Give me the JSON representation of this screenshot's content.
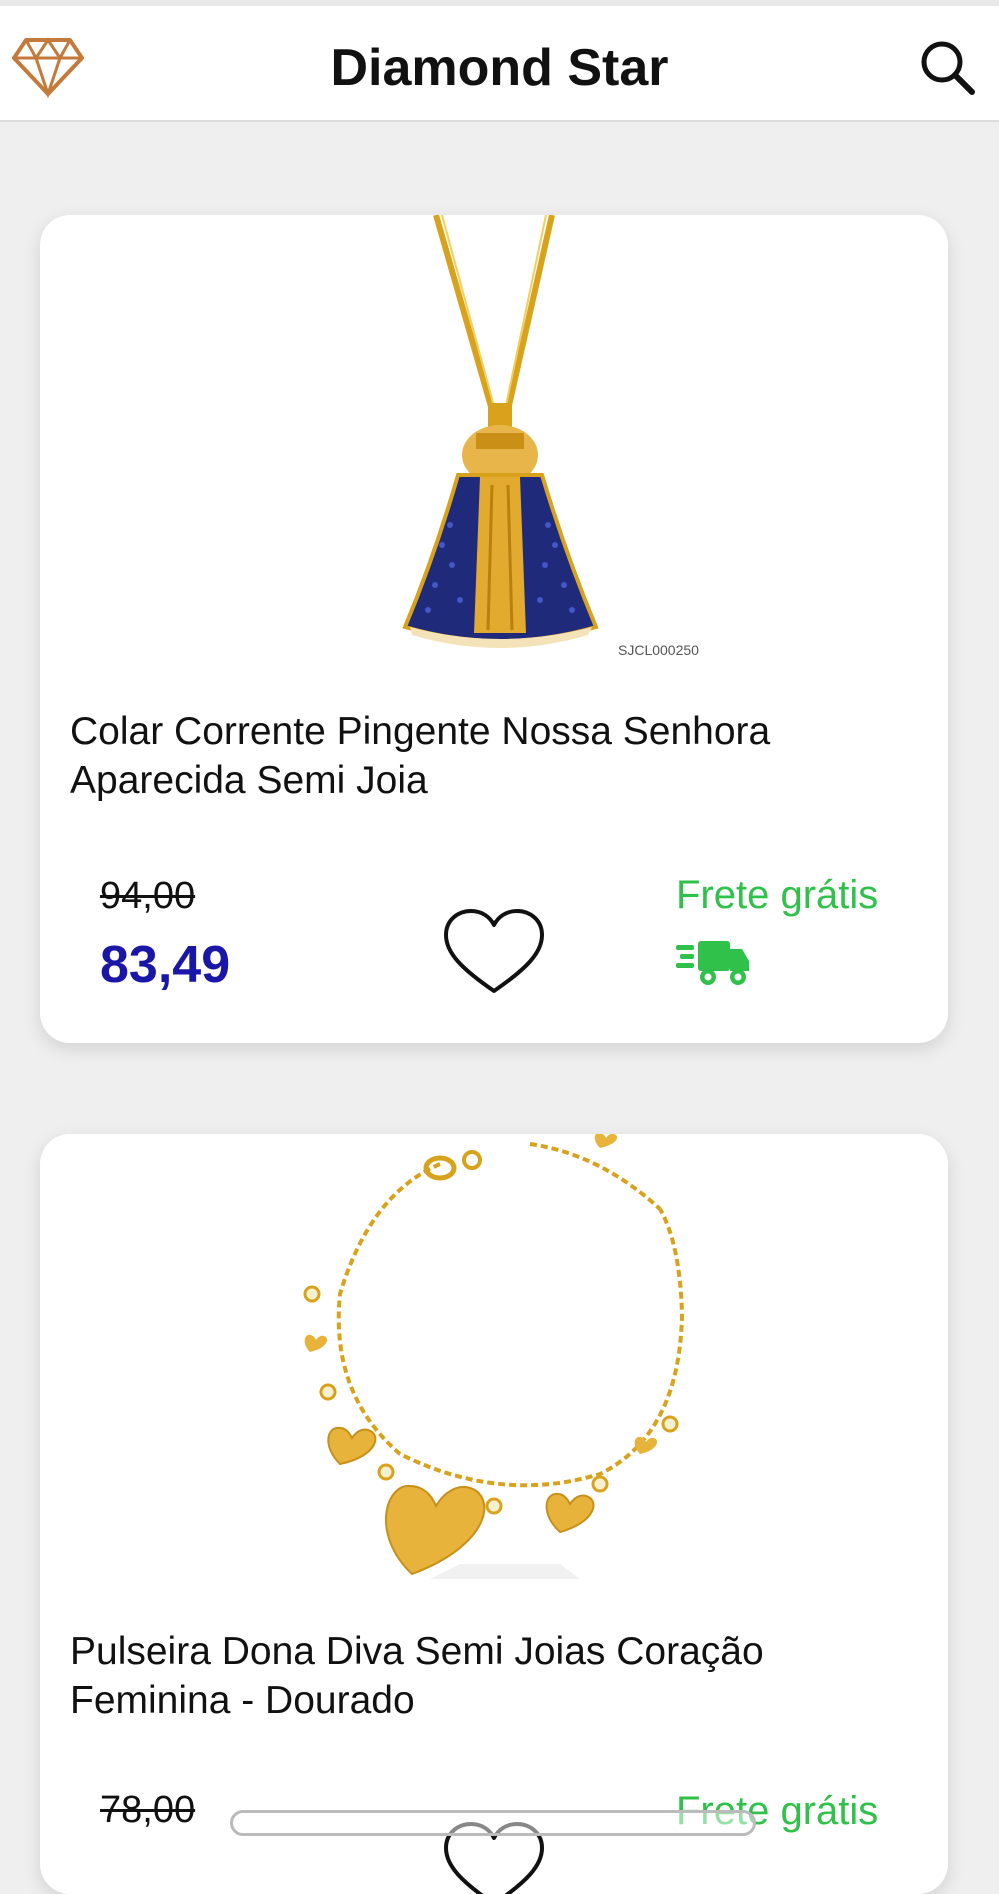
{
  "app": {
    "title": "Diamond Star"
  },
  "icons": {
    "logo": "diamond-icon",
    "search": "search-icon",
    "favorite": "heart-outline-icon",
    "shipping": "truck-fast-icon"
  },
  "colors": {
    "price": "#1a17a8",
    "shipping": "#2fc14a",
    "logo": "#c47a3b"
  },
  "products": [
    {
      "sku_label": "SJCL000250",
      "title": "Colar Corrente Pingente Nossa Senhora Aparecida Semi Joia",
      "old_price": "94,00",
      "price": "83,49",
      "shipping_label": "Frete grátis"
    },
    {
      "title": "Pulseira Dona Diva Semi Joias Coração Feminina - Dourado",
      "old_price": "78,00",
      "shipping_label": "Frete grátis"
    }
  ]
}
